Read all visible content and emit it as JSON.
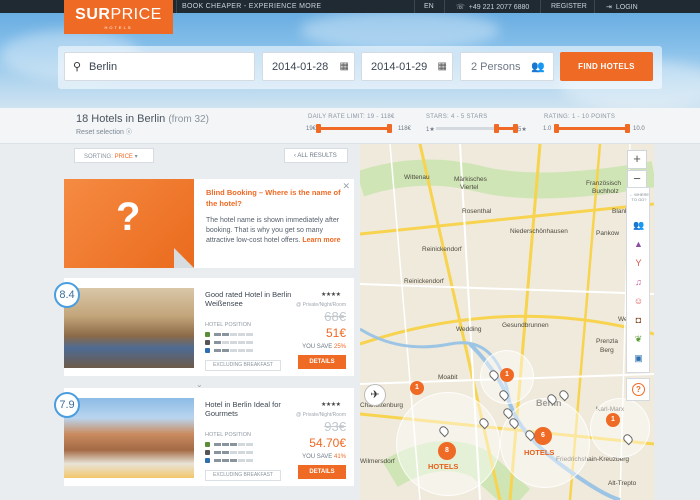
{
  "topbar": {
    "tagline": "BOOK CHEAPER - EXPERIENCE MORE",
    "language": "EN",
    "phone": "+49 221 2077 6880",
    "register": "REGISTER",
    "login": "LOGIN"
  },
  "logo": {
    "name_bold": "SUR",
    "name_rest": "PRICE",
    "sub": "HOTELS"
  },
  "search": {
    "city": "Berlin",
    "checkin": "2014-01-28",
    "checkout": "2014-01-29",
    "persons": "2 Persons",
    "find_label": "FIND HOTELS"
  },
  "filters": {
    "count_text": "18 Hotels in Berlin",
    "from_text": "(from 32)",
    "reset_label": "Reset selection",
    "rate_label": "DAILY RATE LIMIT: 19 - 118€",
    "rate_min": "19€",
    "rate_max": "118€",
    "stars_label": "STARS: 4 - 5 STARS",
    "stars_min": "1★",
    "stars_max": "5★",
    "rating_label": "RATING: 1 - 10 POINTS",
    "rating_min": "1.0",
    "rating_max": "10.0"
  },
  "list": {
    "sorting_label": "SORTING:",
    "sorting_value": "PRICE",
    "all_results": "ALL RESULTS",
    "blind": {
      "title": "Blind Booking – Where is the name of the hotel?",
      "text": "The hotel name is shown immediately after booking. That is why you get so many attractive low-cost hotel offers.",
      "more": "Learn more",
      "symbol": "?"
    },
    "hotels": [
      {
        "rating": "8.4",
        "name": "Good rated Hotel in Berlin Weißensee",
        "stars": "★★★★",
        "position_label": "HOTEL POSITION",
        "per_night": "@ Private/Night/Room",
        "old_price": "68€",
        "new_price": "51€",
        "save_label": "YOU SAVE",
        "save_pct": "25%",
        "breakfast": "EXCLUDING BREAKFAST",
        "details": "DETAILS"
      },
      {
        "rating": "7.9",
        "name": "Hotel in Berlin Ideal for Gourmets",
        "stars": "★★★★",
        "position_label": "HOTEL POSITION",
        "per_night": "@ Private/Night/Room",
        "old_price": "93€",
        "new_price": "54.70€",
        "save_label": "YOU SAVE",
        "save_pct": "41%",
        "breakfast": "EXCLUDING BREAKFAST",
        "details": "DETAILS"
      }
    ]
  },
  "map": {
    "labels": {
      "wittenau": "Wittenau",
      "markische": "Märkisches",
      "viertel": "Viertel",
      "franz": "Französisch",
      "buchholz": "Buchholz",
      "rosenthal": "Rosenthal",
      "blankenburg": "Blankenburg",
      "reinickendorf_1": "Reinickendorf",
      "niederschoenhausen": "Niederschönhausen",
      "pankow": "Pankow",
      "reinickendorf_2": "Reinickendorf",
      "wedding": "Wedding",
      "gesundbrunnen": "Gesundbrunnen",
      "weissensee": "Weißen",
      "prenzlauer": "Prenzla",
      "prenzlauer_2": "Berg",
      "moabit": "Moabit",
      "berlin": "Berlin",
      "charlottenburg": "Charlottenburg",
      "friedrichshain": "Friedrichshain-Kreuzberg",
      "wilmersdorf": "Wilmersdorf",
      "treptow": "Alt-Trepto",
      "karl": "Karl-Marx"
    },
    "clusters": [
      {
        "count": "1",
        "label": ""
      },
      {
        "count": "8",
        "label": "HOTELS"
      },
      {
        "count": "1",
        "label": ""
      },
      {
        "count": "6",
        "label": "HOTELS"
      },
      {
        "count": "1",
        "label": ""
      },
      {
        "count": "1",
        "label": ""
      }
    ],
    "zoom_in": "+",
    "zoom_out": "−",
    "where_label": "← WHERE TO GO?",
    "help": "?",
    "plane_icon": "airport-icon"
  }
}
